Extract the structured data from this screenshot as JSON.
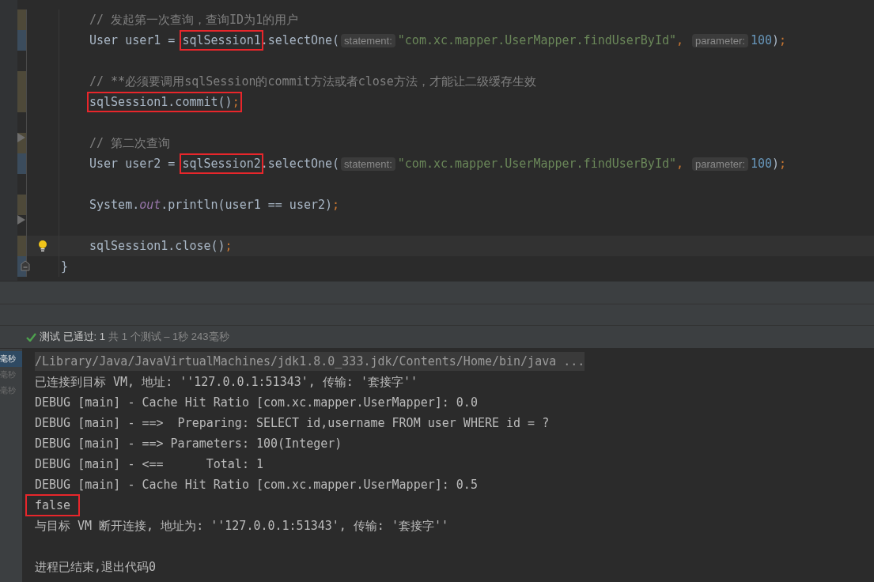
{
  "editor": {
    "lines": [
      {
        "kind": "block",
        "children": [
          {
            "kind": "code",
            "color": "#4e4939",
            "tokens": [
              {
                "kind": "comment",
                "text": "// 发起第一次查询，查询ID为1的用户"
              }
            ]
          },
          {
            "kind": "code",
            "color": "#3b4c5d",
            "tokens": [
              {
                "kind": "plain",
                "text": "User user1 = "
              },
              {
                "kind": "plain",
                "text": "sqlSession1",
                "boxed": true
              },
              {
                "kind": "plain",
                "text": ".selectOne("
              },
              {
                "kind": "hint",
                "text": "statement:"
              },
              {
                "kind": "string",
                "text": "\"com.xc.mapper.UserMapper.findUserById\""
              },
              {
                "kind": "punct",
                "text": ", "
              },
              {
                "kind": "hint",
                "text": "parameter:"
              },
              {
                "kind": "number",
                "text": "100"
              },
              {
                "kind": "plain",
                "text": ")"
              },
              {
                "kind": "punct",
                "text": ";"
              }
            ]
          },
          {
            "kind": "blank"
          },
          {
            "kind": "code",
            "color": "#4e4939",
            "tokens": [
              {
                "kind": "comment",
                "text": "// **必须要调用sqlSession的commit方法或者close方法，才能让二级缓存生效"
              }
            ]
          },
          {
            "kind": "code",
            "color": "#4e4939",
            "tokens": [
              {
                "kind": "plain",
                "text": "sqlSession1.commit()",
                "boxed": true
              },
              {
                "kind": "punct",
                "text": ";",
                "boxed": true
              }
            ]
          },
          {
            "kind": "blank"
          },
          {
            "kind": "code",
            "color": "#4e4939",
            "fold": true,
            "tokens": [
              {
                "kind": "comment",
                "text": "// 第二次查询"
              }
            ]
          },
          {
            "kind": "code",
            "color": "#3b4c5d",
            "tokens": [
              {
                "kind": "plain",
                "text": "User user2 = "
              },
              {
                "kind": "plain",
                "text": "sqlSession2",
                "boxed": true
              },
              {
                "kind": "plain",
                "text": ".selectOne("
              },
              {
                "kind": "hint",
                "text": "statement:"
              },
              {
                "kind": "string",
                "text": "\"com.xc.mapper.UserMapper.findUserById\""
              },
              {
                "kind": "punct",
                "text": ", "
              },
              {
                "kind": "hint",
                "text": "parameter:"
              },
              {
                "kind": "number",
                "text": "100"
              },
              {
                "kind": "plain",
                "text": ")"
              },
              {
                "kind": "punct",
                "text": ";"
              }
            ]
          },
          {
            "kind": "blank"
          },
          {
            "kind": "code",
            "color": "#4e4939",
            "tokens": [
              {
                "kind": "plain",
                "text": "System."
              },
              {
                "kind": "field",
                "text": "out"
              },
              {
                "kind": "plain",
                "text": ".println(user1 == user2)"
              },
              {
                "kind": "punct",
                "text": ";"
              }
            ]
          },
          {
            "kind": "blank",
            "fold": true
          },
          {
            "kind": "code",
            "color": "#4e4939",
            "bulb": true,
            "current": true,
            "tokens": [
              {
                "kind": "plain",
                "text": "sqlSession1.close()"
              },
              {
                "kind": "punct",
                "text": ";"
              }
            ]
          }
        ]
      },
      {
        "kind": "code",
        "color": "#3b4c5d",
        "fold_end": true,
        "tokens": [
          {
            "kind": "plain",
            "text": "}"
          }
        ]
      }
    ]
  },
  "test_status": {
    "passed": true,
    "label": "测试 已通过: 1",
    "summary": "共 1 个测试 – 1秒 243毫秒"
  },
  "console": {
    "side_items": [
      {
        "label": "毫秒",
        "selected": true
      },
      {
        "label": "毫秒",
        "selected": false
      },
      {
        "label": "毫秒",
        "selected": false
      }
    ],
    "lines": [
      {
        "kind": "command",
        "text": "/Library/Java/JavaVirtualMachines/jdk1.8.0_333.jdk/Contents/Home/bin/java ..."
      },
      {
        "kind": "output",
        "text": "已连接到目标 VM, 地址: ''127.0.0.1:51343', 传输: '套接字''"
      },
      {
        "kind": "output",
        "text": "DEBUG [main] - Cache Hit Ratio [com.xc.mapper.UserMapper]: 0.0"
      },
      {
        "kind": "output",
        "text": "DEBUG [main] - ==>  Preparing: SELECT id,username FROM user WHERE id = ?"
      },
      {
        "kind": "output",
        "text": "DEBUG [main] - ==> Parameters: 100(Integer)"
      },
      {
        "kind": "output",
        "text": "DEBUG [main] - <==      Total: 1"
      },
      {
        "kind": "output",
        "text": "DEBUG [main] - Cache Hit Ratio [com.xc.mapper.UserMapper]: 0.5"
      },
      {
        "kind": "output",
        "text": "false",
        "boxed": true
      },
      {
        "kind": "output",
        "text": "与目标 VM 断开连接, 地址为: ''127.0.0.1:51343', 传输: '套接字''"
      },
      {
        "kind": "blank"
      },
      {
        "kind": "output",
        "text": "进程已结束,退出代码0"
      }
    ]
  }
}
